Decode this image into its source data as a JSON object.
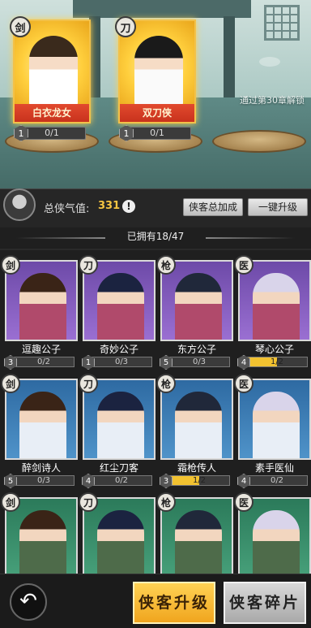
{
  "team": {
    "slots": [
      {
        "weapon": "剑",
        "name": "白衣龙女",
        "level": "1",
        "progress": "0/1"
      },
      {
        "weapon": "刀",
        "name": "双刀侠",
        "level": "1",
        "progress": "0/1"
      }
    ],
    "locked_hint": "通过第30章解锁"
  },
  "stats": {
    "qi_label": "总侠气值:",
    "qi_value": "331",
    "info_icon": "!",
    "bonus_button": "侠客总加成",
    "upgrade_all_button": "一键升级"
  },
  "owned": {
    "label": "已拥有18/47"
  },
  "heroes": [
    {
      "weapon": "剑",
      "name": "逗趣公子",
      "level": "3",
      "progress": "0/2",
      "fill": 0,
      "bg": "purple"
    },
    {
      "weapon": "刀",
      "name": "奇妙公子",
      "level": "1",
      "progress": "0/3",
      "fill": 0,
      "bg": "purple"
    },
    {
      "weapon": "枪",
      "name": "东方公子",
      "level": "5",
      "progress": "0/3",
      "fill": 0,
      "bg": "purple"
    },
    {
      "weapon": "医",
      "name": "琴心公子",
      "level": "4",
      "progress": "1/2",
      "fill": 0.5,
      "bg": "purple"
    },
    {
      "weapon": "剑",
      "name": "醉剑诗人",
      "level": "5",
      "progress": "0/3",
      "fill": 0,
      "bg": "blue"
    },
    {
      "weapon": "刀",
      "name": "红尘刀客",
      "level": "4",
      "progress": "0/2",
      "fill": 0,
      "bg": "blue"
    },
    {
      "weapon": "枪",
      "name": "霜枪传人",
      "level": "3",
      "progress": "1/2",
      "fill": 0.5,
      "bg": "blue"
    },
    {
      "weapon": "医",
      "name": "素手医仙",
      "level": "4",
      "progress": "0/2",
      "fill": 0,
      "bg": "blue"
    },
    {
      "weapon": "剑",
      "name": "",
      "level": "",
      "progress": "",
      "fill": 0,
      "bg": "green"
    },
    {
      "weapon": "刀",
      "name": "",
      "level": "",
      "progress": "",
      "fill": 0,
      "bg": "green"
    },
    {
      "weapon": "枪",
      "name": "",
      "level": "",
      "progress": "",
      "fill": 0,
      "bg": "green"
    },
    {
      "weapon": "医",
      "name": "",
      "level": "",
      "progress": "",
      "fill": 0,
      "bg": "green"
    }
  ],
  "bottom": {
    "back_icon": "back-arrow-icon",
    "upgrade_button": "侠客升级",
    "shards_button": "侠客碎片"
  },
  "colors": {
    "accent_gold": "#f5c542",
    "progress_fill": "#f2c230",
    "name_bar_red": "#d83a22"
  }
}
